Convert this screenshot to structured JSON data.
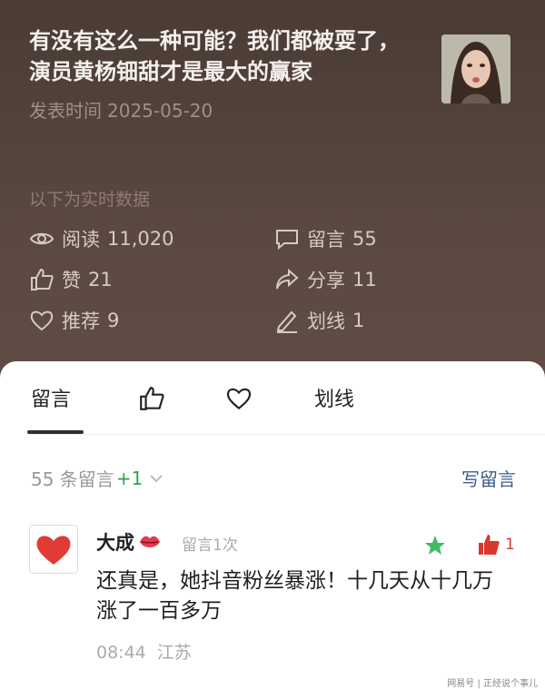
{
  "article": {
    "title": "有没有这么一种可能？我们都被耍了，演员黄杨钿甜才是最大的赢家",
    "publish_label": "发表时间",
    "publish_date": "2025-05-20"
  },
  "stats": {
    "section_label": "以下为实时数据",
    "read": {
      "label": "阅读",
      "value": "11,020",
      "icon": "eye-icon"
    },
    "comments": {
      "label": "留言",
      "value": "55",
      "icon": "comment-icon"
    },
    "likes": {
      "label": "赞",
      "value": "21",
      "icon": "thumbs-up-icon"
    },
    "shares": {
      "label": "分享",
      "value": "11",
      "icon": "share-icon"
    },
    "recommend": {
      "label": "推荐",
      "value": "9",
      "icon": "heart-icon"
    },
    "highlight": {
      "label": "划线",
      "value": "1",
      "icon": "pen-icon"
    }
  },
  "tabs": {
    "comments": "留言",
    "highlight": "划线"
  },
  "comment_list": {
    "count_text": "55 条留言",
    "new_count": "+1",
    "write_label": "写留言"
  },
  "comment": {
    "author": "大成",
    "meta": "留言1次",
    "text": "还真是，她抖音粉丝暴涨！十几天从十几万涨了一百多万",
    "time": "08:44",
    "location": "江苏",
    "likes": "1"
  },
  "watermark": "网易号 | 正经说个事儿",
  "colors": {
    "header_bg": "#4a3b35",
    "link_blue": "#3b5c86",
    "accent_green": "#2fa24f",
    "like_red": "#d9382f"
  }
}
